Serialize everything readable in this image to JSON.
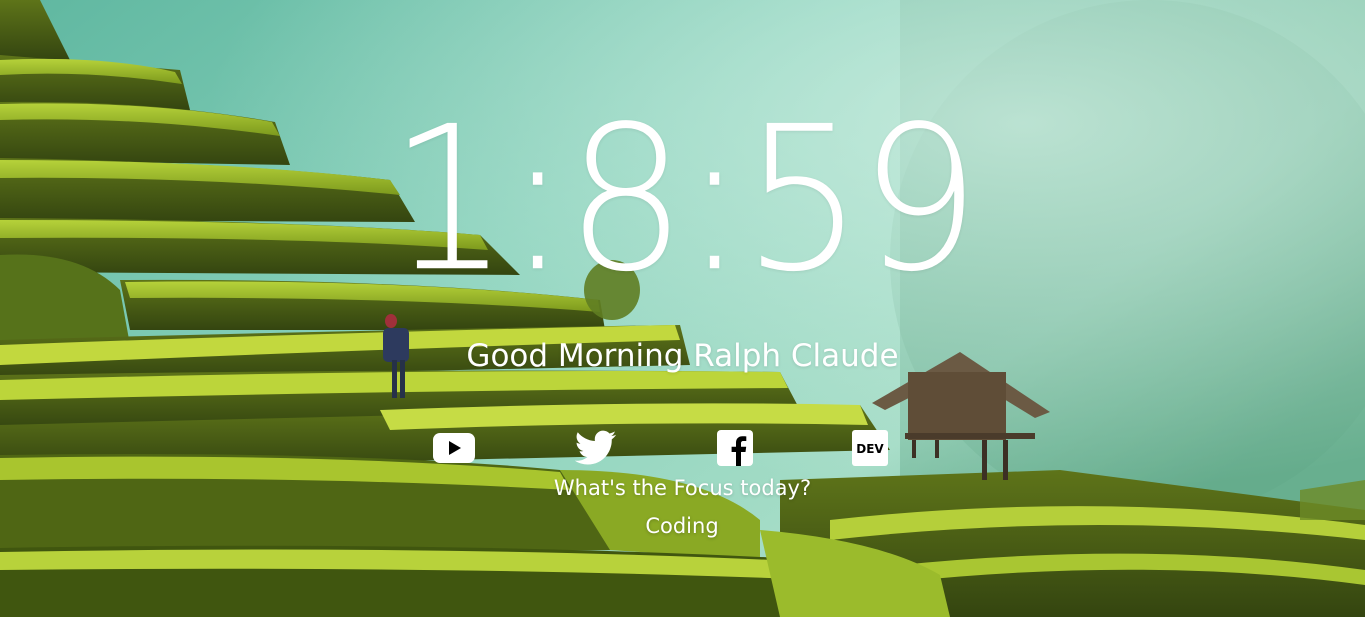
{
  "clock": {
    "time": "1:8:59"
  },
  "greeting": {
    "text": "Good Morning Ralph Claude"
  },
  "socials": [
    {
      "icon": "youtube-icon"
    },
    {
      "icon": "twitter-icon"
    },
    {
      "icon": "facebook-icon"
    },
    {
      "icon": "dev-icon",
      "label": "DEV"
    }
  ],
  "focus": {
    "question": "What's the Focus today?",
    "value": "Coding"
  },
  "colors": {
    "text": "#ffffff",
    "sky_mist": "#8fd6c0",
    "terrace_green": "#9cc22a",
    "dark_terrace": "#3d5414"
  }
}
